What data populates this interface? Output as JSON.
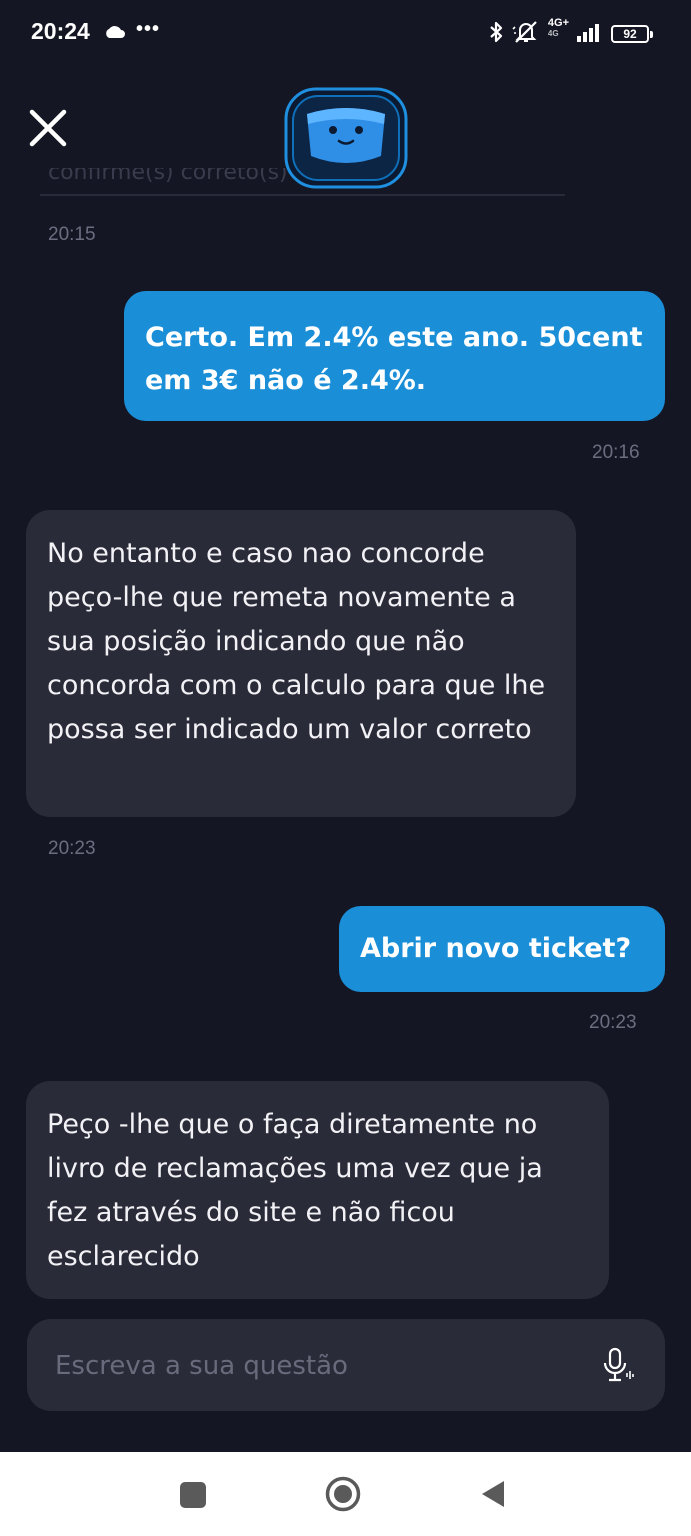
{
  "status_bar": {
    "time": "20:24",
    "dots": "•••",
    "network": "4G+",
    "network_sub": "4G",
    "battery": "92"
  },
  "header": {
    "close_icon": "close-icon",
    "avatar_icon": "bot-avatar-icon",
    "previous_text": "confirme(s) correto(s)"
  },
  "messages": [
    {
      "time": "20:15"
    },
    {
      "sender": "user",
      "text": "Certo. Em 2.4% este ano. 50cent em 3€ não é 2.4%.",
      "time": "20:16"
    },
    {
      "sender": "bot",
      "text": "No entanto e caso nao concorde peço-lhe que remeta novamente a sua posição  indicando que não concorda com o calculo para que lhe possa ser indicado um valor correto",
      "time": "20:23"
    },
    {
      "sender": "user",
      "text": "Abrir novo ticket?",
      "time": "20:23"
    },
    {
      "sender": "bot",
      "text": "Peço -lhe que o faça diretamente no livro de reclamações uma vez que ja fez através do site e não ficou esclarecido"
    }
  ],
  "composer": {
    "placeholder": "Escreva a sua questão",
    "mic_icon": "microphone-icon"
  },
  "colors": {
    "background": "#151623",
    "user_bubble": "#1a8fd8",
    "bot_bubble": "#2a2b38",
    "timestamp": "#6b6e80"
  }
}
